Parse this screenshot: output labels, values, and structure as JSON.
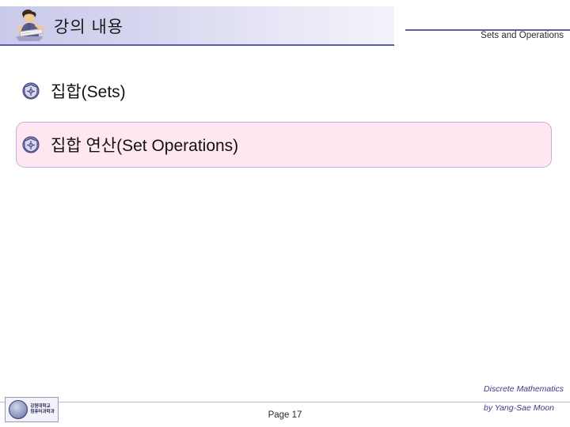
{
  "slide": {
    "title": "강의 내용",
    "header_right": "Sets and Operations",
    "bullets": [
      {
        "text": "집합(Sets)",
        "highlighted": false
      },
      {
        "text": "집합 연산(Set Operations)",
        "highlighted": true
      }
    ],
    "footer": {
      "page_label": "Page 17",
      "credit_line1": "Discrete Mathematics",
      "credit_line2": "by Yang-Sae Moon",
      "logo_text": "강원대학교\n컴퓨터과학과"
    },
    "colors": {
      "title_bar_start": "#c9c9ea",
      "title_bar_end": "#f3f3fb",
      "rule": "#5b5ba8",
      "highlight_bg": "#ffe7f2",
      "highlight_border": "#c4b0d8",
      "credit": "#3b3b8c"
    }
  }
}
